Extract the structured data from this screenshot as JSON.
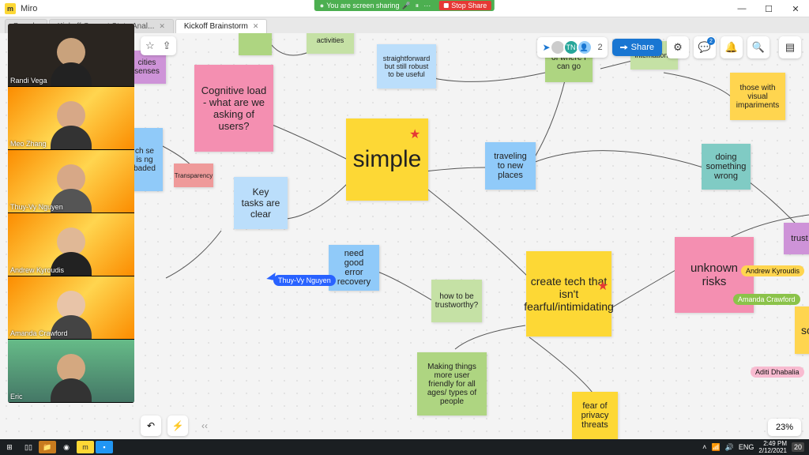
{
  "app": {
    "title": "Miro"
  },
  "tabs": [
    {
      "label": "Boards"
    },
    {
      "label": "Kickoff Current State Anal..."
    },
    {
      "label": "Kickoff Brainstorm"
    }
  ],
  "share_banner": {
    "text": "You are screen sharing",
    "stop": "Stop Share"
  },
  "toolbar": {
    "share": "Share",
    "participants": "2",
    "comment_count": "2"
  },
  "zoom": "23%",
  "notes": {
    "activities": "activities",
    "straightforward": "straightforward but still robust to be useful",
    "where_go": "of where I can go",
    "international": "international",
    "visual": "those with visual impariments",
    "cognitive": "Cognitive load - what are we asking of users?",
    "senses": "cities senses",
    "loaded": "ch se is ng baded",
    "transparency": "Transparency",
    "simple": "simple",
    "traveling": "traveling to new places",
    "wrong": "doing something wrong",
    "keytasks": "Key tasks are clear",
    "recovery": "need good error recovery",
    "trustworthy": "how to be trustworthy?",
    "create_tech": "create tech that isn't fearful/intimidating",
    "unknown": "unknown risks",
    "trust": "trust",
    "sc": "sc",
    "friendly": "Making things more user friendly for all ages/ types of people",
    "privacy": "fear of privacy threats"
  },
  "cursor": {
    "thuy": "Thuy-Vy Nguyen"
  },
  "user_tags": {
    "ak": "Andrew Kyroudis",
    "ac": "Amanda Crawford",
    "ad": "Aditi Dhabalia"
  },
  "participants": [
    {
      "name": "Randi Vega"
    },
    {
      "name": "Meo Zhang"
    },
    {
      "name": "Thuy-Vy Nguyen"
    },
    {
      "name": "Andrew Kyroudis"
    },
    {
      "name": "Amanda Crawford"
    },
    {
      "name": "Eric"
    }
  ],
  "system": {
    "lang": "ENG",
    "time": "2:49 PM",
    "date": "2/12/2021",
    "notif": "20"
  }
}
